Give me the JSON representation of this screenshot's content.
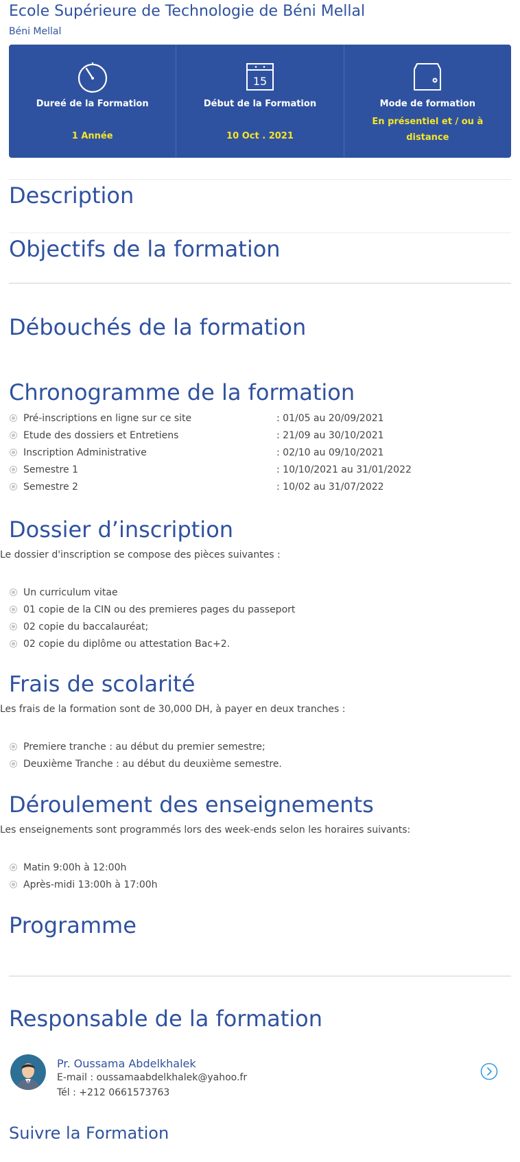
{
  "header": {
    "school": "Ecole Supérieure de Technologie de Béni Mellal",
    "city": "Béni Mellal"
  },
  "info": [
    {
      "icon": "stopwatch-icon",
      "label": "Dureé de la Formation",
      "value": "1 Année"
    },
    {
      "icon": "calendar-icon",
      "calendar_day": "15",
      "label": "Début de la Formation",
      "value": "10 Oct . 2021"
    },
    {
      "icon": "wallet-icon",
      "label": "Mode de formation",
      "value": "En présentiel et / ou à distance"
    }
  ],
  "sections": {
    "description": "Description",
    "objectifs": "Objectifs de la formation",
    "debouches": "Débouchés de la formation",
    "chronogramme": "Chronogramme de la formation",
    "dossier": "Dossier d’inscription",
    "frais": "Frais de scolarité",
    "deroulement": "Déroulement des enseignements",
    "programme": "Programme",
    "responsable": "Responsable de la formation",
    "suivre": "Suivre la Formation"
  },
  "chronogramme": [
    {
      "label": "Pré-inscriptions en ligne sur ce site",
      "date": ": 01/05 au 20/09/2021"
    },
    {
      "label": "Etude des dossiers et Entretiens",
      "date": ": 21/09 au 30/10/2021"
    },
    {
      "label": "Inscription Administrative",
      "date": ": 02/10 au 09/10/2021"
    },
    {
      "label": "Semestre 1",
      "date": ": 10/10/2021 au 31/01/2022"
    },
    {
      "label": "Semestre 2",
      "date": ": 10/02 au 31/07/2022"
    }
  ],
  "dossier": {
    "intro": "Le dossier d'inscription se compose des pièces suivantes :",
    "items": [
      "Un curriculum vitae",
      "01 copie de la CIN ou des premieres pages du passeport",
      "02 copie du baccalauréat;",
      "02 copie du diplôme ou attestation Bac+2."
    ]
  },
  "frais": {
    "intro": "Les frais de la formation sont de 30,000 DH, à payer en deux tranches :",
    "items": [
      "Premiere tranche : au début du premier semestre;",
      "Deuxième Tranche : au début du deuxième semestre."
    ]
  },
  "deroulement": {
    "intro": "Les enseignements sont programmés lors des week-ends selon les horaires suivants:",
    "items": [
      "Matin 9:00h à 12:00h",
      "Après-midi 13:00h à 17:00h"
    ]
  },
  "responsable": {
    "name": "Pr. Oussama Abdelkhalek",
    "email": "E-mail : oussamaabdelkhalek@yahoo.fr",
    "tel": "Tél : +212 0661573763",
    "action_icon": "chevron-right-circle-icon"
  },
  "colors": {
    "brand": "#2f52a0",
    "accent": "#f5e52a",
    "link": "#3a9be0"
  }
}
